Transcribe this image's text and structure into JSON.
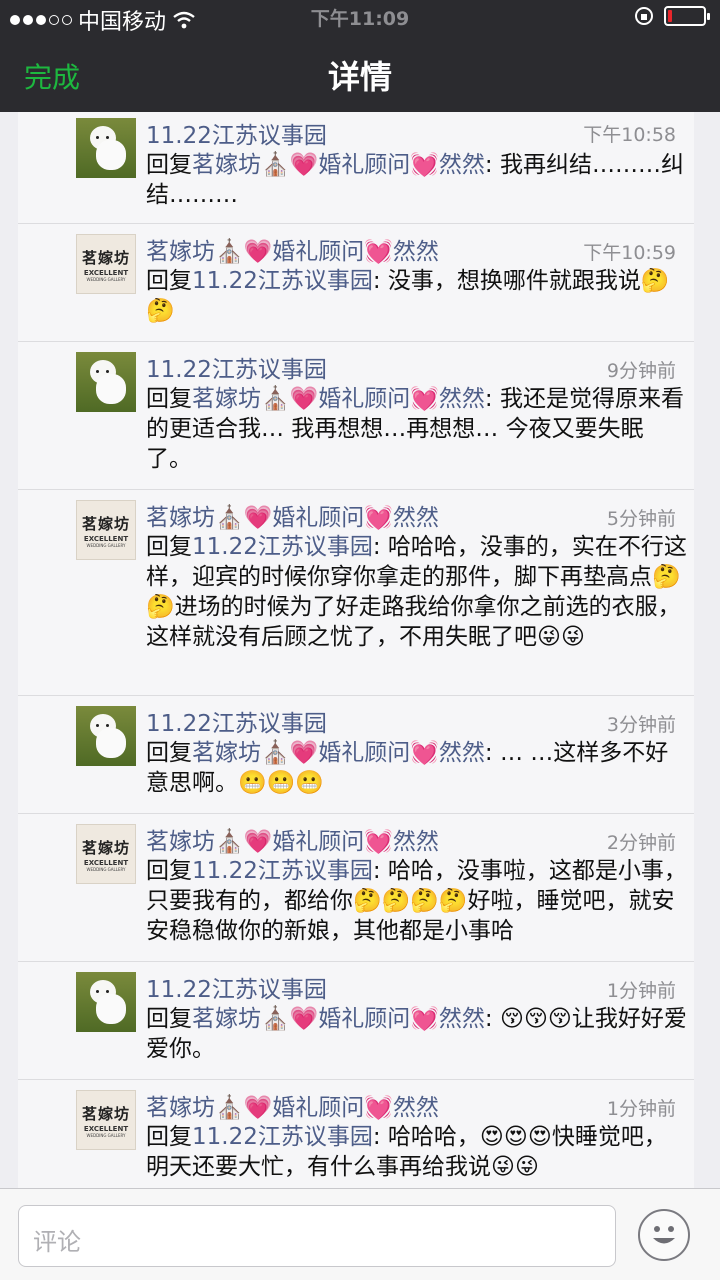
{
  "status_bar": {
    "carrier": "中国移动",
    "time": "下午11:09",
    "battery_level": 0.12,
    "battery_color": "#e8262b"
  },
  "nav": {
    "done_label": "完成",
    "title": "详情",
    "accent": "#1db83f"
  },
  "comments": [
    {
      "name": "11.22江苏议事园",
      "time": "下午10:58",
      "reply_prefix": "回复",
      "reply_to": "茗嫁坊⛪💗婚礼顾问💓然然",
      "text": ": 我再纠结………纠结………",
      "avatar": "poodle-avatar"
    },
    {
      "name": "茗嫁坊⛪💗婚礼顾问💓然然",
      "time": "下午10:59",
      "reply_prefix": "回复",
      "reply_to": "11.22江苏议事园",
      "text": ": 没事，想换哪件就跟我说🤔🤔",
      "avatar": "mingjiafang-logo"
    },
    {
      "name": "11.22江苏议事园",
      "time": "9分钟前",
      "reply_prefix": "回复",
      "reply_to": "茗嫁坊⛪💗婚礼顾问💓然然",
      "text": ": 我还是觉得原来看的更适合我… 我再想想…再想想… 今夜又要失眠了。",
      "avatar": "poodle-avatar"
    },
    {
      "name": "茗嫁坊⛪💗婚礼顾问💓然然",
      "time": "5分钟前",
      "reply_prefix": "回复",
      "reply_to": "11.22江苏议事园",
      "text": ": 哈哈哈，没事的，实在不行这样，迎宾的时候你穿你拿走的那件，脚下再垫高点🤔🤔进场的时候为了好走路我给你拿你之前选的衣服，这样就没有后顾之忧了，不用失眠了吧😜😜",
      "avatar": "mingjiafang-logo"
    },
    {
      "name": "11.22江苏议事园",
      "time": "3分钟前",
      "reply_prefix": "回复",
      "reply_to": "茗嫁坊⛪💗婚礼顾问💓然然",
      "text": ": … …这样多不好意思啊。😬😬😬",
      "avatar": "poodle-avatar"
    },
    {
      "name": "茗嫁坊⛪💗婚礼顾问💓然然",
      "time": "2分钟前",
      "reply_prefix": "回复",
      "reply_to": "11.22江苏议事园",
      "text": ": 哈哈，没事啦，这都是小事，只要我有的，都给你🤔🤔🤔🤔好啦，睡觉吧，就安安稳稳做你的新娘，其他都是小事哈",
      "avatar": "mingjiafang-logo"
    },
    {
      "name": "11.22江苏议事园",
      "time": "1分钟前",
      "reply_prefix": "回复",
      "reply_to": "茗嫁坊⛪💗婚礼顾问💓然然",
      "text": ": 😚😚😚让我好好爱爱你。",
      "avatar": "poodle-avatar"
    },
    {
      "name": "茗嫁坊⛪💗婚礼顾问💓然然",
      "time": "1分钟前",
      "reply_prefix": "回复",
      "reply_to": "11.22江苏议事园",
      "text": ": 哈哈哈，😍😍😍快睡觉吧，明天还要大忙，有什么事再给我说😜😜",
      "avatar": "mingjiafang-logo"
    }
  ],
  "logo": {
    "line1": "茗嫁坊",
    "line2": "EXCELLENT",
    "line3": "WEDDING GALLERY"
  },
  "input": {
    "placeholder": "评论"
  }
}
